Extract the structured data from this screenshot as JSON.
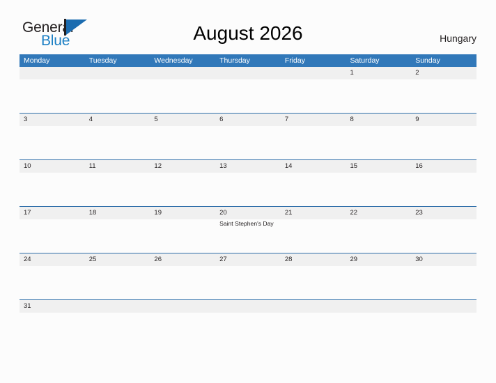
{
  "brand": {
    "name_part1": "General",
    "name_part2": "Blue",
    "color_dark": "#231f20",
    "color_blue": "#1b7fc4",
    "mark_color": "#1b6cb0"
  },
  "header": {
    "title": "August 2026",
    "country": "Hungary"
  },
  "theme": {
    "header_bar": "#3178b9",
    "row_line": "#2b6ca8",
    "daynum_band": "#f0f0f0",
    "page_background": "#fcfcfc",
    "text": "#231f20"
  },
  "calendar": {
    "weekdays": [
      "Monday",
      "Tuesday",
      "Wednesday",
      "Thursday",
      "Friday",
      "Saturday",
      "Sunday"
    ],
    "weeks": [
      {
        "days": [
          {
            "date": "",
            "event": ""
          },
          {
            "date": "",
            "event": ""
          },
          {
            "date": "",
            "event": ""
          },
          {
            "date": "",
            "event": ""
          },
          {
            "date": "",
            "event": ""
          },
          {
            "date": "1",
            "event": ""
          },
          {
            "date": "2",
            "event": ""
          }
        ]
      },
      {
        "days": [
          {
            "date": "3",
            "event": ""
          },
          {
            "date": "4",
            "event": ""
          },
          {
            "date": "5",
            "event": ""
          },
          {
            "date": "6",
            "event": ""
          },
          {
            "date": "7",
            "event": ""
          },
          {
            "date": "8",
            "event": ""
          },
          {
            "date": "9",
            "event": ""
          }
        ]
      },
      {
        "days": [
          {
            "date": "10",
            "event": ""
          },
          {
            "date": "11",
            "event": ""
          },
          {
            "date": "12",
            "event": ""
          },
          {
            "date": "13",
            "event": ""
          },
          {
            "date": "14",
            "event": ""
          },
          {
            "date": "15",
            "event": ""
          },
          {
            "date": "16",
            "event": ""
          }
        ]
      },
      {
        "days": [
          {
            "date": "17",
            "event": ""
          },
          {
            "date": "18",
            "event": ""
          },
          {
            "date": "19",
            "event": ""
          },
          {
            "date": "20",
            "event": "Saint Stephen's Day"
          },
          {
            "date": "21",
            "event": ""
          },
          {
            "date": "22",
            "event": ""
          },
          {
            "date": "23",
            "event": ""
          }
        ]
      },
      {
        "days": [
          {
            "date": "24",
            "event": ""
          },
          {
            "date": "25",
            "event": ""
          },
          {
            "date": "26",
            "event": ""
          },
          {
            "date": "27",
            "event": ""
          },
          {
            "date": "28",
            "event": ""
          },
          {
            "date": "29",
            "event": ""
          },
          {
            "date": "30",
            "event": ""
          }
        ]
      },
      {
        "days": [
          {
            "date": "31",
            "event": ""
          },
          {
            "date": "",
            "event": ""
          },
          {
            "date": "",
            "event": ""
          },
          {
            "date": "",
            "event": ""
          },
          {
            "date": "",
            "event": ""
          },
          {
            "date": "",
            "event": ""
          },
          {
            "date": "",
            "event": ""
          }
        ]
      }
    ]
  }
}
